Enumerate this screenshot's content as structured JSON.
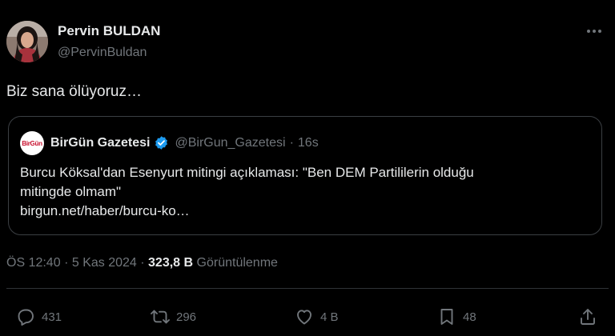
{
  "tweet": {
    "author_name": "Pervin BULDAN",
    "author_handle": "@PervinBuldan",
    "text": "Biz sana ölüyoruz…"
  },
  "quote": {
    "logo_text": "BirGün",
    "name": "BirGün Gazetesi",
    "handle": "@BirGun_Gazetesi",
    "separator": "·",
    "time": "16s",
    "lines": [
      "Burcu Köksal'dan Esenyurt mitingi açıklaması: \"Ben DEM Partililerin olduğu",
      "mitingde olmam\"",
      "birgun.net/haber/burcu-ko…"
    ]
  },
  "meta": {
    "time": "ÖS 12:40",
    "separator": "·",
    "date": "5 Kas 2024",
    "views_count": "323,8 B",
    "views_label": "Görüntülenme"
  },
  "actions": {
    "reply_count": "431",
    "repost_count": "296",
    "like_count": "4 B",
    "bookmark_count": "48"
  },
  "icons": {
    "more": "more-horizontal-icon",
    "verified": "verified-badge-icon",
    "reply": "reply-icon",
    "repost": "repost-icon",
    "like": "heart-icon",
    "bookmark": "bookmark-icon",
    "share": "share-icon"
  },
  "colors": {
    "background": "#000000",
    "text_primary": "#e7e9ea",
    "text_secondary": "#71767b",
    "verified_blue": "#1d9bf0",
    "border": "#3b3f43",
    "brand_red": "#c8102e"
  }
}
